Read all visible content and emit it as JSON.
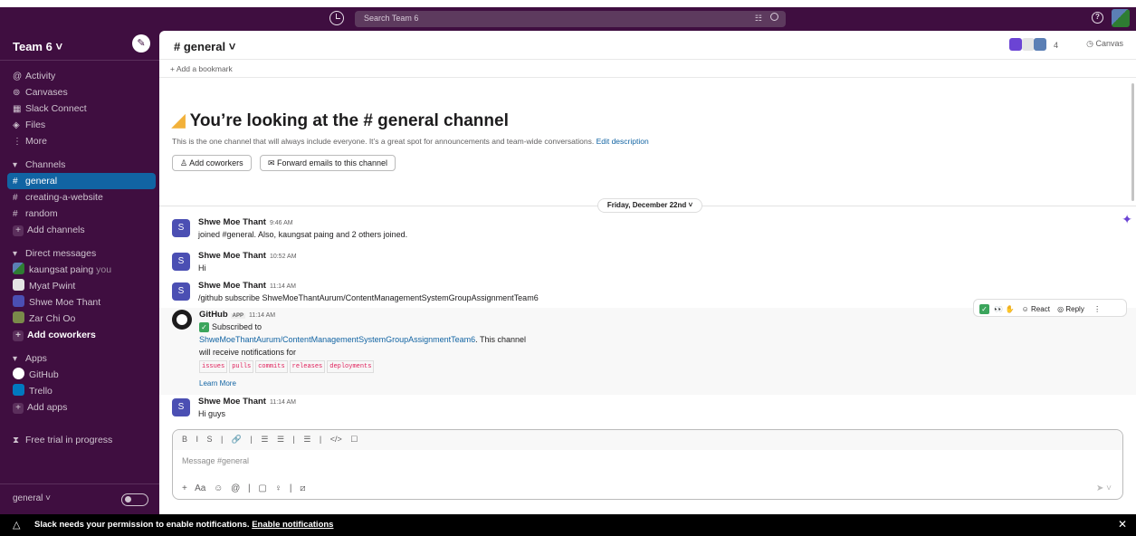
{
  "topbar": {
    "search_placeholder": "Search Team 6"
  },
  "sidebar": {
    "workspace": "Team 6 ˅",
    "nav": [
      "Activity",
      "Canvases",
      "Slack Connect",
      "Files",
      "More"
    ],
    "channels_header": "Channels",
    "channels": [
      "general",
      "creating-a-website",
      "random"
    ],
    "add_channels": "Add channels",
    "dm_header": "Direct messages",
    "dms": [
      {
        "name": "kaungsat paing",
        "suffix": "you"
      },
      {
        "name": "Myat Pwint"
      },
      {
        "name": "Shwe Moe Thant"
      },
      {
        "name": "Zar Chi Oo"
      }
    ],
    "add_coworkers": "Add coworkers",
    "apps_header": "Apps",
    "apps": [
      "GitHub",
      "Trello"
    ],
    "add_apps": "Add apps",
    "trial": "Free trial in progress",
    "footer_channel": "general ˅"
  },
  "channel": {
    "title": "# general ˅",
    "member_count": "4",
    "canvas_label": "Canvas",
    "bookmark": "+ Add a bookmark",
    "intro_title": "You’re looking at the # general channel",
    "intro_desc": "This is the one channel that will always include everyone. It’s a great spot for announcements and team-wide conversations.",
    "edit_desc": "Edit description",
    "btn_add_coworkers": "Add coworkers",
    "btn_forward": "Forward emails to this channel",
    "date": "Friday, December 22nd ˅"
  },
  "messages": [
    {
      "author": "Shwe Moe Thant",
      "time": "9:46 AM",
      "text": "joined #general. Also, kaungsat paing and 2 others joined."
    },
    {
      "author": "Shwe Moe Thant",
      "time": "10:52 AM",
      "text": "Hi"
    },
    {
      "author": "Shwe Moe Thant",
      "time": "11:14 AM",
      "text": "/github subscribe ShweMoeThantAurum/ContentManagementSystemGroupAssignmentTeam6"
    },
    {
      "author": "GitHub",
      "badge": "APP",
      "time": "11:14 AM",
      "line1": "Subscribed to",
      "link": "ShweMoeThantAurum/ContentManagementSystemGroupAssignmentTeam6",
      "line2": ". This channel",
      "line3": "will receive notifications for",
      "codes": [
        "issues",
        "pulls",
        "commits",
        "releases",
        "deployments"
      ],
      "learn": "Learn More"
    },
    {
      "author": "Shwe Moe Thant",
      "time": "11:14 AM",
      "text": "Hi guys"
    }
  ],
  "hover": {
    "react": "React",
    "reply": "Reply"
  },
  "composer": {
    "placeholder": "Message #general",
    "fmt": "B I S | 🔗 | ☰ ☰ | ☰ | </> ☐",
    "tools": "+ Aa ☺ @ | ▢ ♀ | ⧄"
  },
  "notif": {
    "text": "Slack needs your permission to enable notifications.",
    "link": "Enable notifications"
  }
}
